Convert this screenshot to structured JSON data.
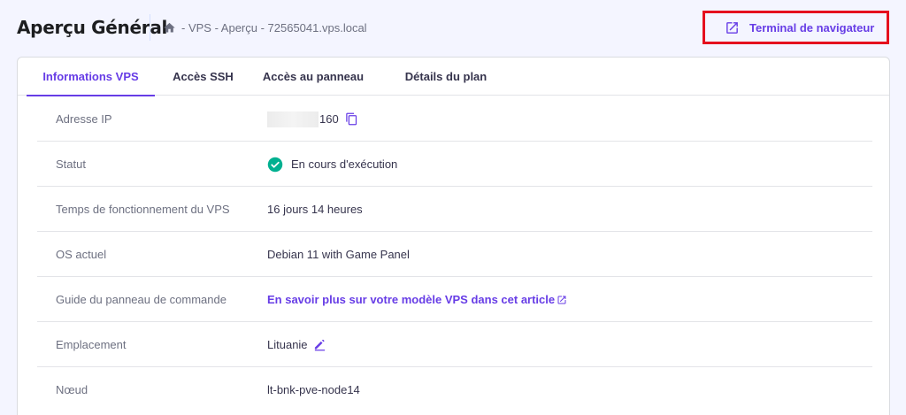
{
  "header": {
    "title": "Aperçu Général",
    "breadcrumb": "- VPS - Aperçu - 72565041.vps.local",
    "terminal_button": "Terminal de navigateur"
  },
  "tabs": [
    {
      "label": "Informations VPS",
      "active": true
    },
    {
      "label": "Accès SSH",
      "active": false
    },
    {
      "label": "Accès au panneau",
      "active": false
    },
    {
      "label": "Détails du plan",
      "active": false
    }
  ],
  "rows": {
    "ip": {
      "label": "Adresse IP",
      "value_suffix": "160"
    },
    "status": {
      "label": "Statut",
      "value": "En cours d'exécution"
    },
    "uptime": {
      "label": "Temps de fonctionnement du VPS",
      "value": "16 jours 14 heures"
    },
    "os": {
      "label": "OS actuel",
      "value": "Debian 11 with Game Panel"
    },
    "guide": {
      "label": "Guide du panneau de commande",
      "value": "En savoir plus sur votre modèle VPS dans cet article"
    },
    "location": {
      "label": "Emplacement",
      "value": "Lituanie"
    },
    "node": {
      "label": "Nœud",
      "value": "lt-bnk-pve-node14"
    }
  },
  "colors": {
    "accent": "#673de6",
    "success": "#00b090",
    "highlight_border": "#e5101e"
  },
  "icons": [
    "home-icon",
    "external-link-icon",
    "copy-icon",
    "check-circle-icon",
    "pencil-icon"
  ]
}
